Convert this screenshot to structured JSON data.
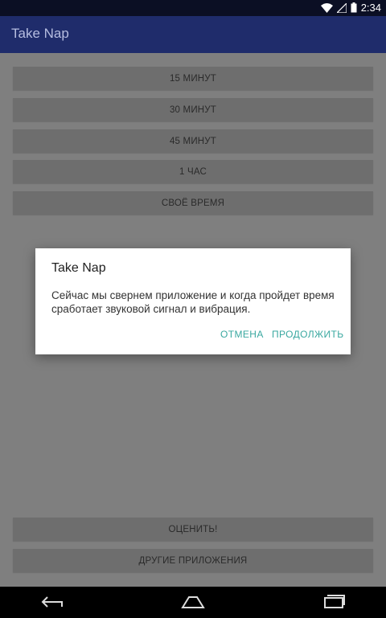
{
  "status_bar": {
    "time": "2:34"
  },
  "app_bar": {
    "title": "Take Nap"
  },
  "options": [
    {
      "label": "15 МИНУТ"
    },
    {
      "label": "30 МИНУТ"
    },
    {
      "label": "45 МИНУТ"
    },
    {
      "label": "1 ЧАС"
    },
    {
      "label": "СВОЁ ВРЕМЯ"
    }
  ],
  "bottom_buttons": {
    "rate_label": "ОЦЕНИТЬ!",
    "other_apps_label": "ДРУГИЕ ПРИЛОЖЕНИЯ"
  },
  "dialog": {
    "title": "Take Nap",
    "message": "Сейчас мы свернем приложение и когда пройдет время сработает звуковой сигнал и вибрация.",
    "cancel_label": "ОТМЕНА",
    "continue_label": "ПРОДОЛЖИТЬ"
  },
  "colors": {
    "app_bar": "#1f2c6b",
    "accent": "#3aa8a0",
    "button": "#6e6e6e",
    "background_dimmed": "#7f7f7f"
  },
  "icons": {
    "status": [
      "wifi-icon",
      "signal-icon",
      "battery-icon"
    ],
    "nav": [
      "back-icon",
      "home-icon",
      "recents-icon"
    ]
  }
}
